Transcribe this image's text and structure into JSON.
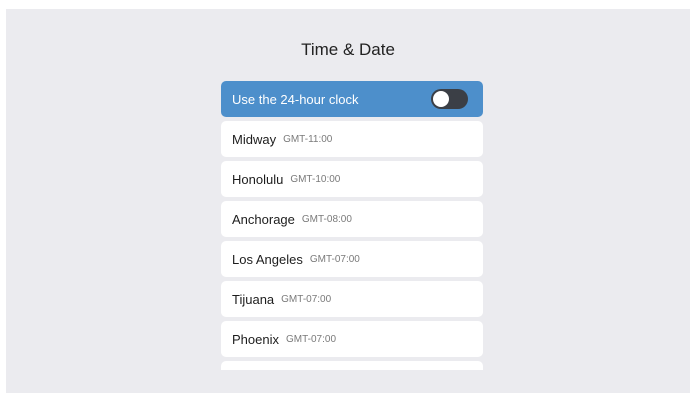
{
  "title": "Time & Date",
  "clock_toggle": {
    "label": "Use the 24-hour clock",
    "enabled": false
  },
  "zones": [
    {
      "city": "Midway",
      "offset": "GMT-11:00"
    },
    {
      "city": "Honolulu",
      "offset": "GMT-10:00"
    },
    {
      "city": "Anchorage",
      "offset": "GMT-08:00"
    },
    {
      "city": "Los Angeles",
      "offset": "GMT-07:00"
    },
    {
      "city": "Tijuana",
      "offset": "GMT-07:00"
    },
    {
      "city": "Phoenix",
      "offset": "GMT-07:00"
    },
    {
      "city": "",
      "offset": ""
    }
  ]
}
